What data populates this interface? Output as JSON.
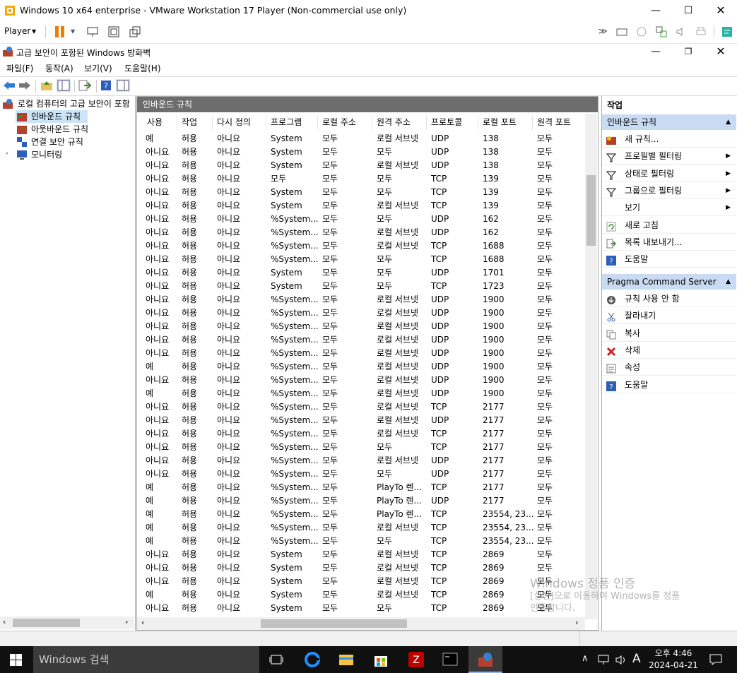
{
  "vm": {
    "title": "Windows 10 x64 enterprise - VMware Workstation 17 Player (Non-commercial use only)",
    "player_label": "Player"
  },
  "mmc": {
    "title": "고급 보안이 포함된 Windows 방화벽",
    "menu": [
      "파일(F)",
      "동작(A)",
      "보기(V)",
      "도움말(H)"
    ]
  },
  "tree": {
    "root": "로컬 컴퓨터의 고급 보안이 포함",
    "items": [
      "인바운드 규칙",
      "아웃바운드 규칙",
      "연결 보안 규칙",
      "모니터링"
    ]
  },
  "center": {
    "header": "인바운드 규칙",
    "columns": [
      "사용",
      "작업",
      "다시 정의",
      "프로그램",
      "로컬 주소",
      "원격 주소",
      "프로토콜",
      "로컬 포트",
      "원격 포트"
    ],
    "rows": [
      [
        "예",
        "허용",
        "아니요",
        "System",
        "모두",
        "로컬 서브넷",
        "UDP",
        "138",
        "모두"
      ],
      [
        "아니요",
        "허용",
        "아니요",
        "System",
        "모두",
        "모두",
        "UDP",
        "138",
        "모두"
      ],
      [
        "아니요",
        "허용",
        "아니요",
        "System",
        "모두",
        "로컬 서브넷",
        "UDP",
        "138",
        "모두"
      ],
      [
        "아니요",
        "허용",
        "아니요",
        "모두",
        "모두",
        "모두",
        "TCP",
        "139",
        "모두"
      ],
      [
        "아니요",
        "허용",
        "아니요",
        "System",
        "모두",
        "모두",
        "TCP",
        "139",
        "모두"
      ],
      [
        "아니요",
        "허용",
        "아니요",
        "System",
        "모두",
        "로컬 서브넷",
        "TCP",
        "139",
        "모두"
      ],
      [
        "아니요",
        "허용",
        "아니요",
        "%System...",
        "모두",
        "모두",
        "UDP",
        "162",
        "모두"
      ],
      [
        "아니요",
        "허용",
        "아니요",
        "%System...",
        "모두",
        "로컬 서브넷",
        "UDP",
        "162",
        "모두"
      ],
      [
        "아니요",
        "허용",
        "아니요",
        "%System...",
        "모두",
        "로컬 서브넷",
        "TCP",
        "1688",
        "모두"
      ],
      [
        "아니요",
        "허용",
        "아니요",
        "%System...",
        "모두",
        "모두",
        "TCP",
        "1688",
        "모두"
      ],
      [
        "아니요",
        "허용",
        "아니요",
        "System",
        "모두",
        "모두",
        "UDP",
        "1701",
        "모두"
      ],
      [
        "아니요",
        "허용",
        "아니요",
        "System",
        "모두",
        "모두",
        "TCP",
        "1723",
        "모두"
      ],
      [
        "아니요",
        "허용",
        "아니요",
        "%System...",
        "모두",
        "로컬 서브넷",
        "UDP",
        "1900",
        "모두"
      ],
      [
        "아니요",
        "허용",
        "아니요",
        "%System...",
        "모두",
        "로컬 서브넷",
        "UDP",
        "1900",
        "모두"
      ],
      [
        "아니요",
        "허용",
        "아니요",
        "%System...",
        "모두",
        "로컬 서브넷",
        "UDP",
        "1900",
        "모두"
      ],
      [
        "아니요",
        "허용",
        "아니요",
        "%System...",
        "모두",
        "로컬 서브넷",
        "UDP",
        "1900",
        "모두"
      ],
      [
        "아니요",
        "허용",
        "아니요",
        "%System...",
        "모두",
        "로컬 서브넷",
        "UDP",
        "1900",
        "모두"
      ],
      [
        "예",
        "허용",
        "아니요",
        "%System...",
        "모두",
        "로컬 서브넷",
        "UDP",
        "1900",
        "모두"
      ],
      [
        "아니요",
        "허용",
        "아니요",
        "%System...",
        "모두",
        "로컬 서브넷",
        "UDP",
        "1900",
        "모두"
      ],
      [
        "예",
        "허용",
        "아니요",
        "%System...",
        "모두",
        "로컬 서브넷",
        "UDP",
        "1900",
        "모두"
      ],
      [
        "아니요",
        "허용",
        "아니요",
        "%System...",
        "모두",
        "로컬 서브넷",
        "TCP",
        "2177",
        "모두"
      ],
      [
        "아니요",
        "허용",
        "아니요",
        "%System...",
        "모두",
        "로컬 서브넷",
        "UDP",
        "2177",
        "모두"
      ],
      [
        "아니요",
        "허용",
        "아니요",
        "%System...",
        "모두",
        "로컬 서브넷",
        "TCP",
        "2177",
        "모두"
      ],
      [
        "아니요",
        "허용",
        "아니요",
        "%System...",
        "모두",
        "모두",
        "TCP",
        "2177",
        "모두"
      ],
      [
        "아니요",
        "허용",
        "아니요",
        "%System...",
        "모두",
        "로컬 서브넷",
        "UDP",
        "2177",
        "모두"
      ],
      [
        "아니요",
        "허용",
        "아니요",
        "%System...",
        "모두",
        "모두",
        "UDP",
        "2177",
        "모두"
      ],
      [
        "예",
        "허용",
        "아니요",
        "%System...",
        "모두",
        "PlayTo 렌...",
        "TCP",
        "2177",
        "모두"
      ],
      [
        "예",
        "허용",
        "아니요",
        "%System...",
        "모두",
        "PlayTo 렌...",
        "UDP",
        "2177",
        "모두"
      ],
      [
        "예",
        "허용",
        "아니요",
        "%System...",
        "모두",
        "PlayTo 렌...",
        "TCP",
        "23554, 23...",
        "모두"
      ],
      [
        "예",
        "허용",
        "아니요",
        "%System...",
        "모두",
        "로컬 서브넷",
        "TCP",
        "23554, 23...",
        "모두"
      ],
      [
        "예",
        "허용",
        "아니요",
        "%System...",
        "모두",
        "모두",
        "TCP",
        "23554, 23...",
        "모두"
      ],
      [
        "아니요",
        "허용",
        "아니요",
        "System",
        "모두",
        "로컬 서브넷",
        "TCP",
        "2869",
        "모두"
      ],
      [
        "아니요",
        "허용",
        "아니요",
        "System",
        "모두",
        "로컬 서브넷",
        "TCP",
        "2869",
        "모두"
      ],
      [
        "아니요",
        "허용",
        "아니요",
        "System",
        "모두",
        "로컬 서브넷",
        "TCP",
        "2869",
        "모두"
      ],
      [
        "예",
        "허용",
        "아니요",
        "System",
        "모두",
        "로컬 서브넷",
        "TCP",
        "2869",
        "모두"
      ],
      [
        "아니요",
        "허용",
        "아니요",
        "System",
        "모두",
        "모두",
        "TCP",
        "2869",
        "모두"
      ]
    ]
  },
  "actions": {
    "title": "작업",
    "section1": "인바운드 규칙",
    "section1_items": [
      "새 규칙...",
      "프로필별 필터링",
      "상태로 필터링",
      "그룹으로 필터링",
      "보기",
      "새로 고침",
      "목록 내보내기...",
      "도움말"
    ],
    "section2": "Pragma Command Server",
    "section2_items": [
      "규칙 사용 안 함",
      "잘라내기",
      "복사",
      "삭제",
      "속성",
      "도움말"
    ]
  },
  "watermark": {
    "title": "Windows 정품 인증",
    "line1": "[설정]으로 이동하여 Windows를 정품",
    "line2": "인증합니다."
  },
  "taskbar": {
    "search_placeholder": "Windows 검색",
    "ime": "A",
    "time": "오후 4:46",
    "date": "2024-04-21"
  }
}
